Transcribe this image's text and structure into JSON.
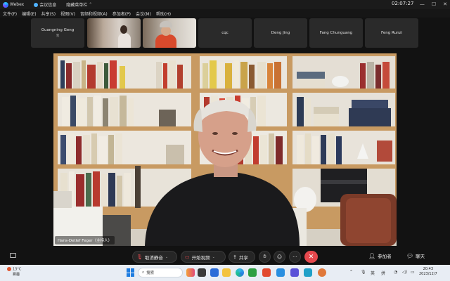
{
  "titlebar": {
    "app_name": "Webex",
    "meeting_info": "会议信息",
    "hide_menu": "隐藏菜单栏",
    "time": "02:07:27"
  },
  "menu": [
    "文件(F)",
    "编辑(E)",
    "共享(S)",
    "视图(V)",
    "音频和视频(A)",
    "参加者(P)",
    "会议(M)",
    "帮助(H)"
  ],
  "participants": [
    {
      "name": "Guangning Geng",
      "sub": "我",
      "video": false
    },
    {
      "name": "",
      "video": true
    },
    {
      "name": "",
      "video": true
    },
    {
      "name": "cqc",
      "video": false
    },
    {
      "name": "Deng Jing",
      "video": false
    },
    {
      "name": "Fang Chunguang",
      "video": false
    },
    {
      "name": "Feng Runzi",
      "video": false
    }
  ],
  "main_video": {
    "label": "Hans-Detlef Feger（主持人）"
  },
  "toolbar": {
    "unmute": "取消静音",
    "start_video": "开始视频",
    "share": "共享",
    "more": "···",
    "participants": "参加者",
    "chat": "聊天"
  },
  "taskbar": {
    "weather_temp": "13°C",
    "weather_desc": "雾霾",
    "search_placeholder": "搜索",
    "ime": "英",
    "ime2": "拼",
    "time": "20:43",
    "date": "2023/12/7"
  },
  "colors": {
    "end_button": "#e5484d",
    "taskbar_bg": "#e8edf4",
    "toolbar_bg": "#121212"
  }
}
